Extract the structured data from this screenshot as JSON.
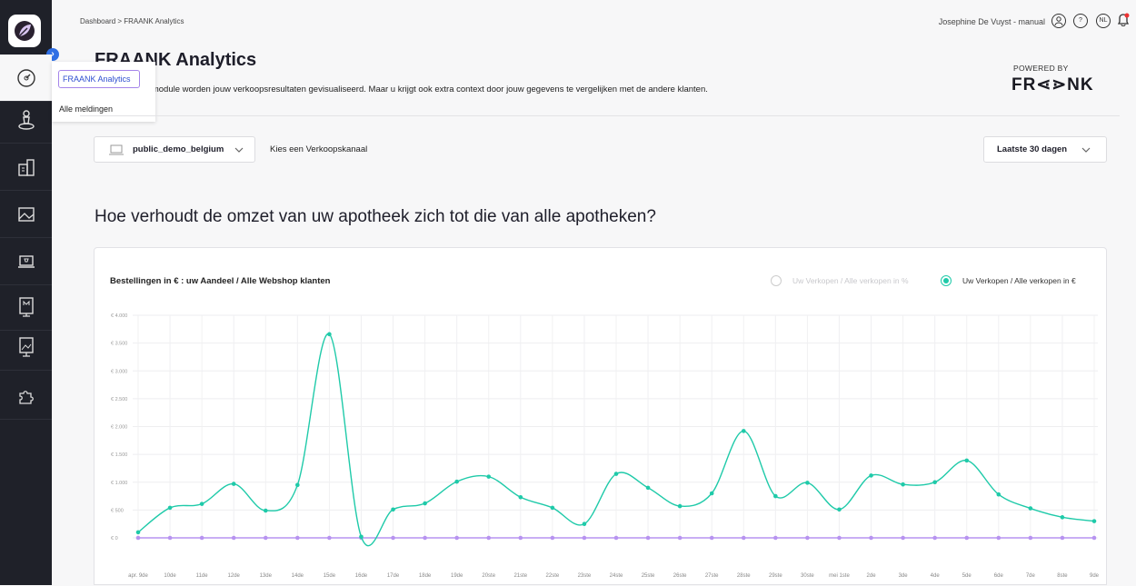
{
  "breadcrumb": "Dashboard  >  FRAANK Analytics",
  "header": {
    "user": "Josephine De Vuyst - manual",
    "lang": "NL",
    "help": "?"
  },
  "flyout": {
    "items": [
      "FRAANK Analytics",
      "Alle meldingen"
    ]
  },
  "page": {
    "title": "FRAANK Analytics",
    "description": "NK module worden jouw verkoopsresultaten gevisualiseerd. Maar u krijgt ook extra context door jouw gegevens te vergelijken met de andere klanten.",
    "powered_by": "POWERED BY",
    "brand": "FR⋖⋗NK"
  },
  "filters": {
    "store": "public_demo_belgium",
    "channel_label": "Kies een Verkoopskanaal",
    "period": "Laatste 30 dagen"
  },
  "section_title": "Hoe verhoudt de omzet van uw apotheek zich tot die van alle apotheken?",
  "chart": {
    "title": "Bestellingen in € : uw Aandeel / Alle Webshop klanten",
    "options": [
      "Uw Verkopen / Alle verkopen in %",
      "Uw Verkopen / Alle verkopen in €"
    ],
    "selected_option": 1
  },
  "colors": {
    "accent": "#1fcaa9",
    "secondary": "#b793f0",
    "highlight": "#2f4fd0"
  },
  "chart_data": {
    "type": "line",
    "title": "Bestellingen in € : uw Aandeel / Alle Webshop klanten",
    "y_ticks": [
      "€ 4.000",
      "€ 3.500",
      "€ 3.000",
      "€ 2.500",
      "€ 2.000",
      "€ 1.500",
      "€ 1.000",
      "€ 500",
      "€ 0"
    ],
    "ylim": [
      0,
      4000
    ],
    "categories": [
      "apr. 9de",
      "10de",
      "11de",
      "12de",
      "13de",
      "14de",
      "15de",
      "16de",
      "17de",
      "18de",
      "19de",
      "20ste",
      "21ste",
      "22ste",
      "23ste",
      "24ste",
      "25ste",
      "26ste",
      "27ste",
      "28ste",
      "29ste",
      "30ste",
      "mei 1ste",
      "2de",
      "3de",
      "4de",
      "5de",
      "6de",
      "7de",
      "8ste",
      "9de"
    ],
    "series": [
      {
        "values": [
          100,
          540,
          610,
          970,
          490,
          950,
          3660,
          20,
          510,
          620,
          1010,
          1100,
          730,
          540,
          250,
          1150,
          900,
          570,
          800,
          1920,
          750,
          990,
          510,
          1120,
          960,
          1000,
          1390,
          780,
          530,
          370,
          300
        ]
      },
      {
        "values": [
          0,
          0,
          0,
          0,
          0,
          0,
          0,
          0,
          0,
          0,
          0,
          0,
          0,
          0,
          0,
          0,
          0,
          0,
          0,
          0,
          0,
          0,
          0,
          0,
          0,
          0,
          0,
          0,
          0,
          0,
          0
        ]
      }
    ],
    "legend": "top-right",
    "grid": true
  }
}
